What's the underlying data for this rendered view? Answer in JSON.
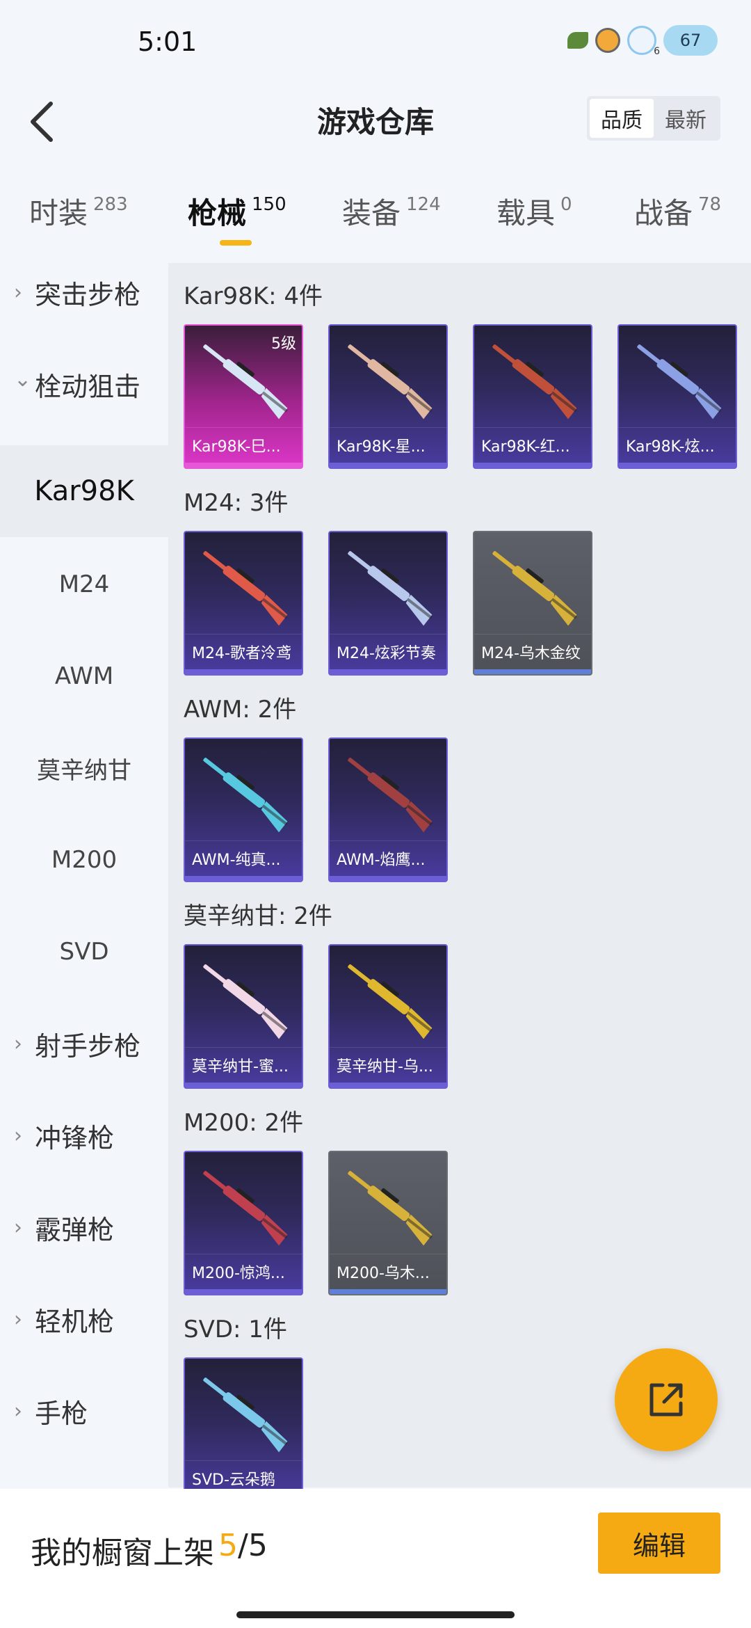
{
  "status": {
    "time": "5:01",
    "battery": "67",
    "bubble_count": "6"
  },
  "header": {
    "title": "游戏仓库",
    "sort": [
      "品质",
      "最新"
    ]
  },
  "categories": [
    {
      "label": "时装",
      "count": "283"
    },
    {
      "label": "枪械",
      "count": "150"
    },
    {
      "label": "装备",
      "count": "124"
    },
    {
      "label": "载具",
      "count": "0"
    },
    {
      "label": "战备",
      "count": "78"
    }
  ],
  "sidebar": [
    {
      "label": "突击步枪",
      "type": "group",
      "expanded": false
    },
    {
      "label": "栓动狙击",
      "type": "group",
      "expanded": true
    },
    {
      "label": "Kar98K",
      "type": "sub",
      "selected": true
    },
    {
      "label": "M24",
      "type": "sub"
    },
    {
      "label": "AWM",
      "type": "sub"
    },
    {
      "label": "莫辛纳甘",
      "type": "sub"
    },
    {
      "label": "M200",
      "type": "sub"
    },
    {
      "label": "SVD",
      "type": "sub"
    },
    {
      "label": "射手步枪",
      "type": "group",
      "expanded": false
    },
    {
      "label": "冲锋枪",
      "type": "group",
      "expanded": false
    },
    {
      "label": "霰弹枪",
      "type": "group",
      "expanded": false
    },
    {
      "label": "轻机枪",
      "type": "group",
      "expanded": false
    },
    {
      "label": "手枪",
      "type": "group",
      "expanded": false
    }
  ],
  "sections": [
    {
      "title": "Kar98K: 4件",
      "items": [
        {
          "name": "Kar98K-巳...",
          "rarity": "pink",
          "level": "5级",
          "color": "#d7e6f5"
        },
        {
          "name": "Kar98K-星...",
          "rarity": "purple",
          "color": "#e0b7a0"
        },
        {
          "name": "Kar98K-红...",
          "rarity": "purple",
          "color": "#c0503a"
        },
        {
          "name": "Kar98K-炫...",
          "rarity": "purple",
          "color": "#8ca0e6"
        }
      ]
    },
    {
      "title": "M24: 3件",
      "items": [
        {
          "name": "M24-歌者泠鸢",
          "rarity": "purple",
          "color": "#e05a4a"
        },
        {
          "name": "M24-炫彩节奏",
          "rarity": "purple",
          "color": "#b8c8ec"
        },
        {
          "name": "M24-乌木金纹",
          "rarity": "gray",
          "color": "#d7b23a"
        }
      ]
    },
    {
      "title": "AWM: 2件",
      "items": [
        {
          "name": "AWM-纯真...",
          "rarity": "purple",
          "color": "#58c8e0"
        },
        {
          "name": "AWM-焰鹰...",
          "rarity": "purple",
          "color": "#a04040"
        }
      ]
    },
    {
      "title": "莫辛纳甘: 2件",
      "items": [
        {
          "name": "莫辛纳甘-蜜...",
          "rarity": "purple",
          "color": "#f2d8e6"
        },
        {
          "name": "莫辛纳甘-乌...",
          "rarity": "purple",
          "color": "#e0b830"
        }
      ]
    },
    {
      "title": "M200: 2件",
      "items": [
        {
          "name": "M200-惊鸿...",
          "rarity": "purple",
          "color": "#c04050"
        },
        {
          "name": "M200-乌木...",
          "rarity": "gray",
          "color": "#d7b23a"
        }
      ]
    },
    {
      "title": "SVD: 1件",
      "items": [
        {
          "name": "SVD-云朵鹅",
          "rarity": "purple",
          "color": "#7cc8ea"
        }
      ]
    }
  ],
  "footer": {
    "label": "我的橱窗上架",
    "current": "5",
    "total": "/5",
    "edit": "编辑"
  },
  "accent": "#f5a913"
}
